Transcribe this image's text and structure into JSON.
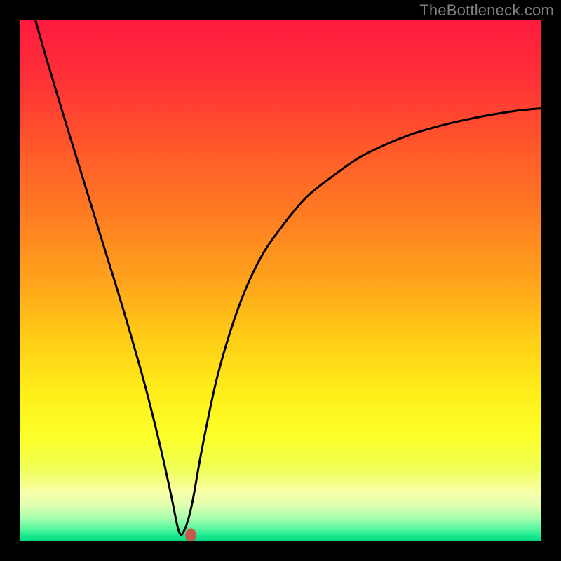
{
  "watermark": "TheBottleneck.com",
  "chart_data": {
    "type": "line",
    "title": "",
    "xlabel": "",
    "ylabel": "",
    "xlim": [
      0,
      100
    ],
    "ylim": [
      0,
      100
    ],
    "grid": false,
    "legend": false,
    "series": [
      {
        "name": "bottleneck-curve",
        "x": [
          3,
          5,
          8,
          12,
          16,
          20,
          24,
          27,
          29,
          30.5,
          31.5,
          33,
          35,
          38,
          42,
          46,
          50,
          55,
          60,
          65,
          70,
          75,
          80,
          85,
          90,
          95,
          100
        ],
        "y": [
          100,
          93,
          83,
          70,
          57,
          44,
          30,
          18,
          9,
          2,
          2,
          7,
          18,
          32,
          45,
          54,
          60,
          66,
          70,
          73.5,
          76,
          78,
          79.5,
          80.7,
          81.7,
          82.5,
          83
        ]
      }
    ],
    "marker": {
      "x": 32.8,
      "y": 1.2,
      "color": "#c35a4d"
    },
    "background_gradient": {
      "stops": [
        {
          "offset": 0.0,
          "color": "#ff1a3f"
        },
        {
          "offset": 0.12,
          "color": "#ff3236"
        },
        {
          "offset": 0.25,
          "color": "#ff5a2a"
        },
        {
          "offset": 0.38,
          "color": "#ff7e22"
        },
        {
          "offset": 0.5,
          "color": "#ffa31c"
        },
        {
          "offset": 0.62,
          "color": "#ffd016"
        },
        {
          "offset": 0.72,
          "color": "#fff01a"
        },
        {
          "offset": 0.8,
          "color": "#fcff2a"
        },
        {
          "offset": 0.86,
          "color": "#f0ff55"
        },
        {
          "offset": 0.905,
          "color": "#f8ffa8"
        },
        {
          "offset": 0.93,
          "color": "#e2ffb0"
        },
        {
          "offset": 0.955,
          "color": "#a8ffb0"
        },
        {
          "offset": 0.975,
          "color": "#5cf7a0"
        },
        {
          "offset": 0.99,
          "color": "#18e88f"
        },
        {
          "offset": 1.0,
          "color": "#00d97e"
        }
      ]
    }
  }
}
